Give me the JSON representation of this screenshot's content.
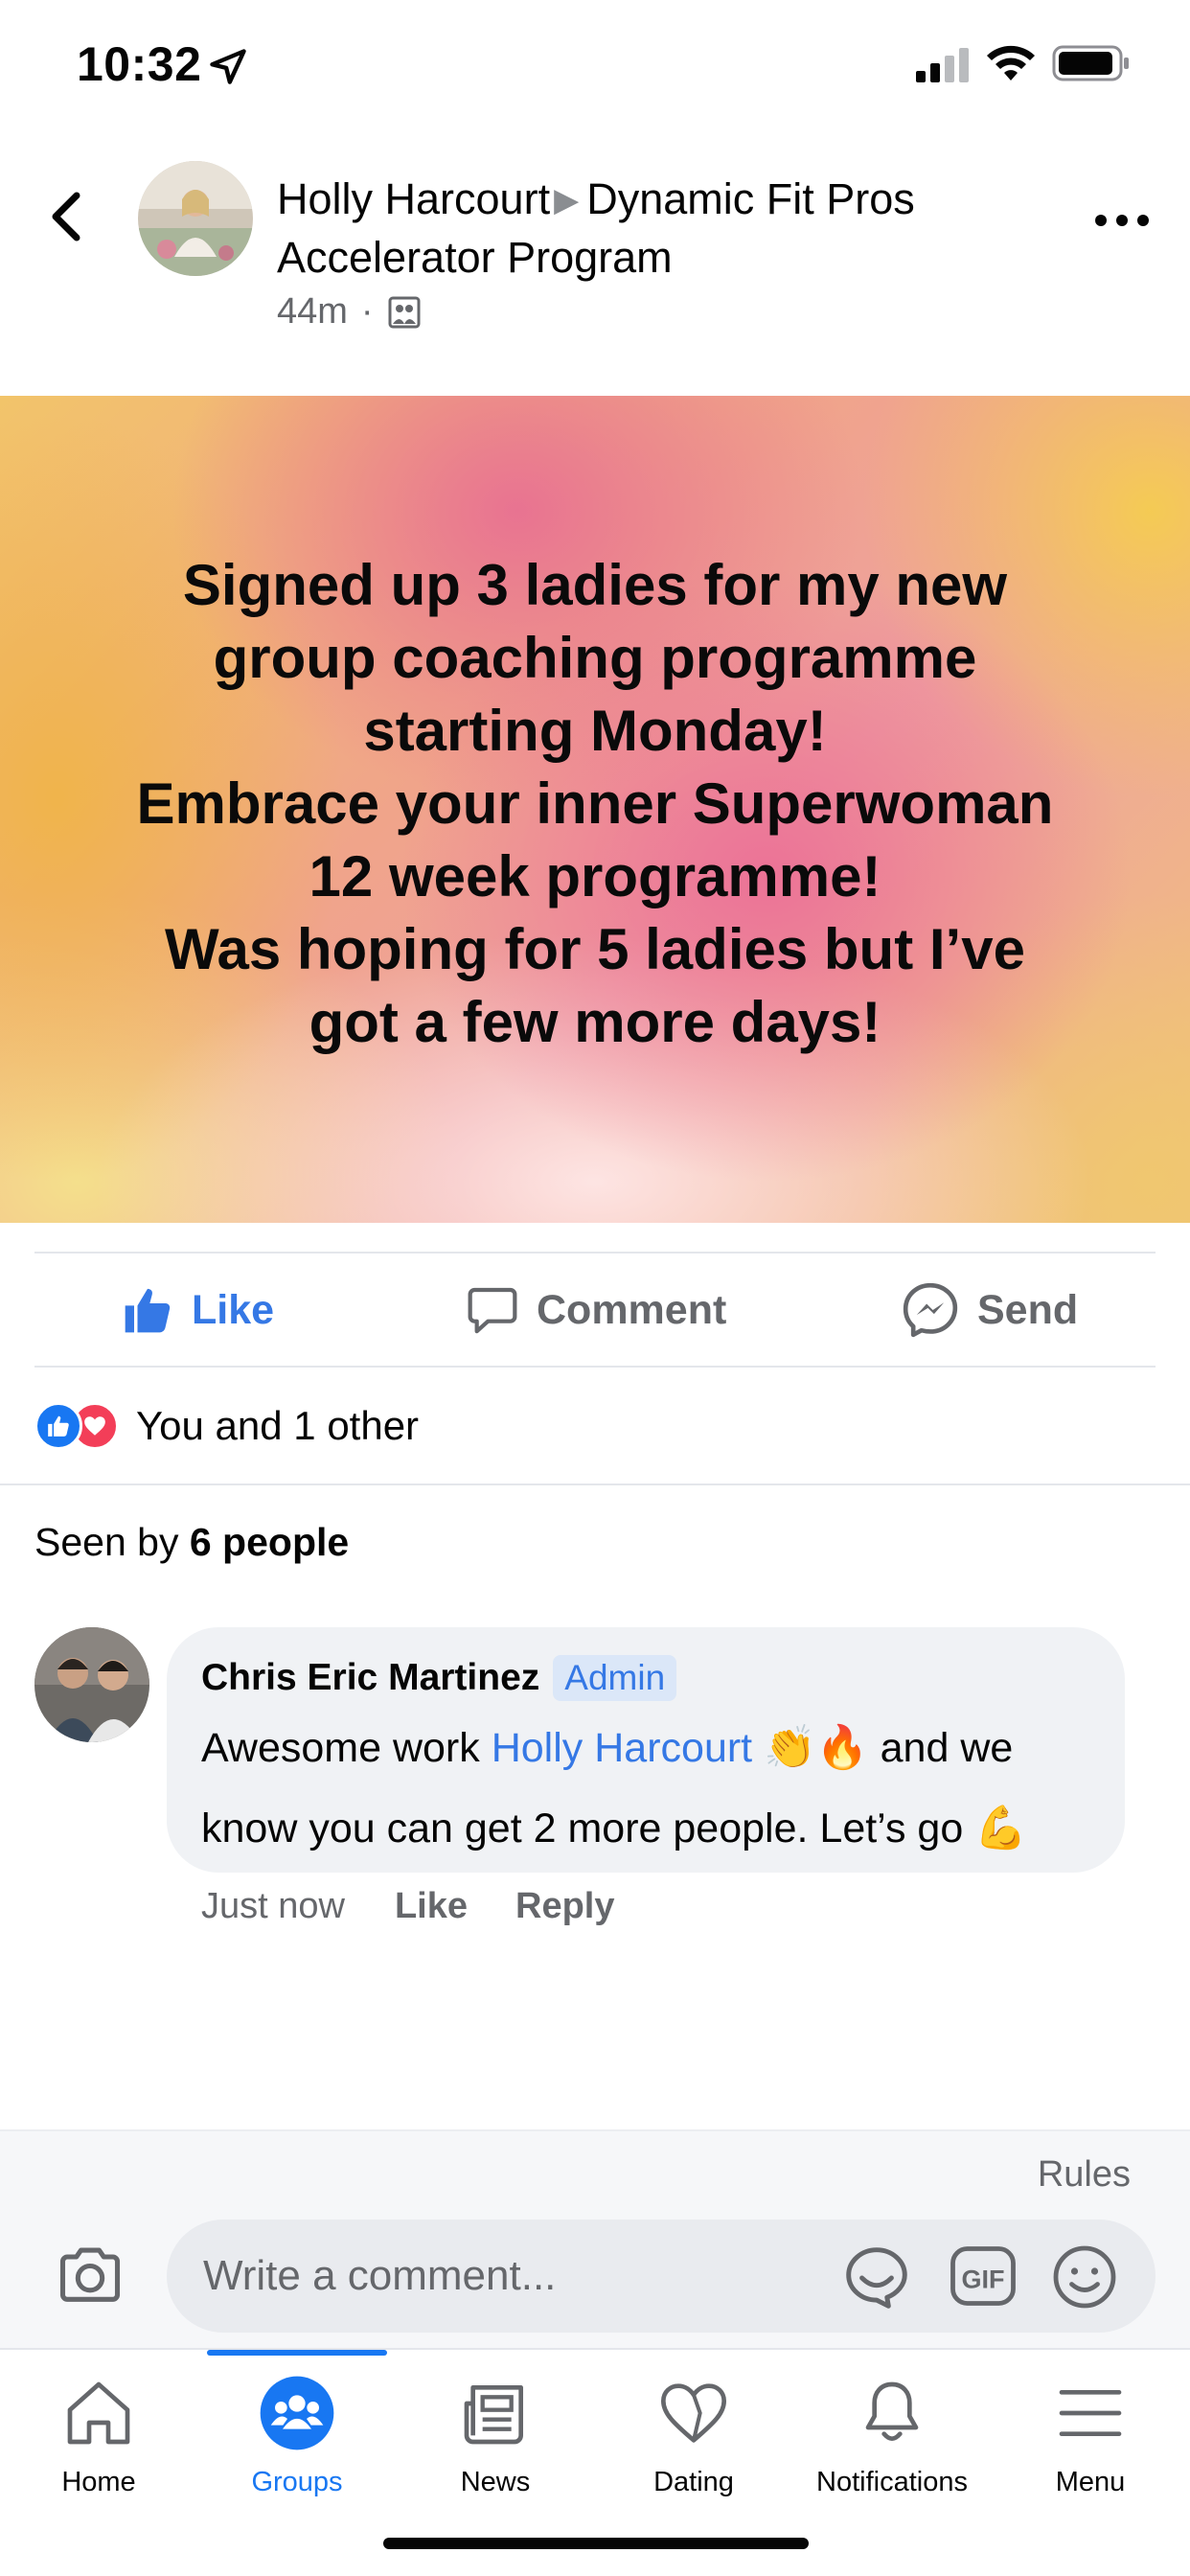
{
  "status_bar": {
    "time": "10:32"
  },
  "post": {
    "author": "Holly Harcourt",
    "group": "Dynamic Fit Pros Accelerator Program",
    "time_ago": "44m",
    "banner_text": "Signed up 3 ladies for my new\ngroup coaching programme\nstarting Monday!\nEmbrace your inner Superwoman\n12 week programme!\nWas hoping for 5 ladies but I’ve\ngot a few more days!"
  },
  "actions": {
    "like": "Like",
    "comment": "Comment",
    "send": "Send"
  },
  "reactions": {
    "summary": "You and 1 other"
  },
  "seen_by": {
    "prefix": "Seen by",
    "count": "6 people"
  },
  "comment": {
    "author": "Chris Eric Martinez",
    "badge": "Admin",
    "text_1": "Awesome work",
    "mention": "Holly Harcourt",
    "text_2": "and we",
    "text_3": "know you can get 2 more people. Let’s go",
    "time": "Just now",
    "like": "Like",
    "reply": "Reply"
  },
  "composer": {
    "rules": "Rules",
    "placeholder": "Write a comment..."
  },
  "tabs": [
    {
      "label": "Home",
      "icon": "home-icon"
    },
    {
      "label": "Groups",
      "icon": "groups-icon",
      "active": true
    },
    {
      "label": "News",
      "icon": "news-icon"
    },
    {
      "label": "Dating",
      "icon": "dating-icon"
    },
    {
      "label": "Notifications",
      "icon": "bell-icon"
    },
    {
      "label": "Menu",
      "icon": "menu-icon"
    }
  ],
  "colors": {
    "brand_blue": "#1877f2",
    "link_blue": "#3578e5",
    "secondary_text": "#65676b"
  }
}
